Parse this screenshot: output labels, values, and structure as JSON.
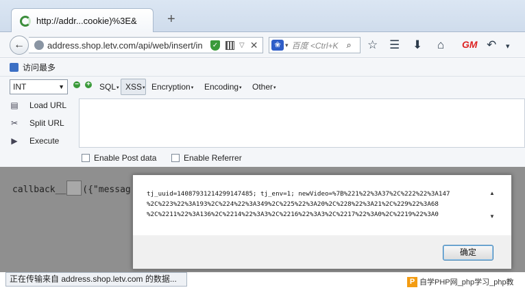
{
  "browser": {
    "tab_title": "http://addr...cookie)%3E&",
    "new_tab": "+",
    "url": "address.shop.letv.com/api/web/insert/in",
    "search_placeholder": "百度 <Ctrl+K",
    "bookmark_label": "访问最多"
  },
  "hackbar": {
    "select_value": "INT",
    "menus": [
      "SQL",
      "XSS",
      "Encryption",
      "Encoding",
      "Other"
    ],
    "actions": [
      "Load URL",
      "Split URL",
      "Execute"
    ],
    "checkboxes": [
      "Enable Post data",
      "Enable Referrer"
    ]
  },
  "page": {
    "text_before": "callback__",
    "text_after": "({\"messag"
  },
  "dialog": {
    "lines": [
      "tj_uuid=14087931214299147485; tj_env=1; newVideo=%7B%221%22%3A37%2C%222%22%3A147",
      "%2C%223%22%3A193%2C%224%22%3A349%2C%225%22%3A20%2C%228%22%3A21%2C%229%22%3A68",
      "%2C%2211%22%3A136%2C%2214%22%3A3%2C%2216%22%3A3%2C%2217%22%3A0%2C%2219%22%3A0"
    ],
    "ok_label": "确定"
  },
  "status_text": "正在传输来自 address.shop.letv.com 的数据...",
  "watermark_text": "自学PHP网_php学习_php教"
}
